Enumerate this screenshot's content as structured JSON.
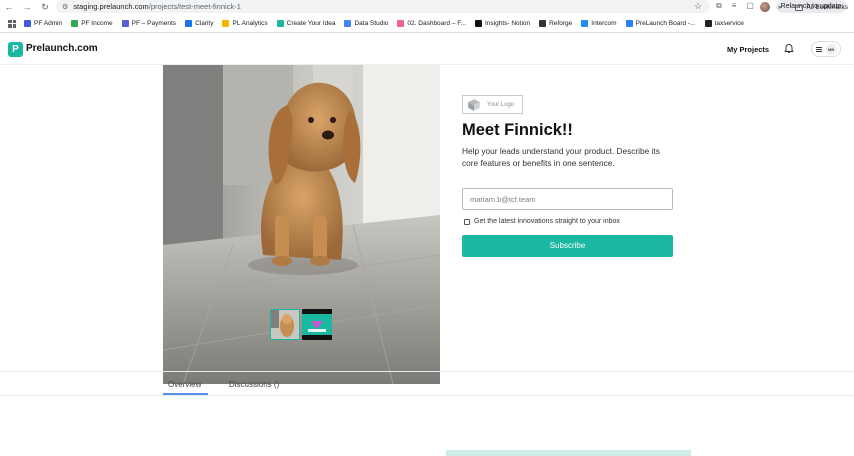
{
  "browser": {
    "url_host": "staging.prelaunch.com",
    "url_path": "/projects/test-meet-finnick-1",
    "relaunch_label": "Relaunch to update"
  },
  "bookmarks": [
    {
      "label": "PF Admin",
      "color": "#3b5bdb"
    },
    {
      "label": "PF Income",
      "color": "#34a853"
    },
    {
      "label": "PF – Payments",
      "color": "#5b5bd6"
    },
    {
      "label": "Clarity",
      "color": "#1a73e8"
    },
    {
      "label": "PL Analytics",
      "color": "#f4b400"
    },
    {
      "label": "Create Your Idea",
      "color": "#1ab8a0"
    },
    {
      "label": "Data Studio",
      "color": "#4285f4"
    },
    {
      "label": "02. Dashboard – F...",
      "color": "#f06292"
    },
    {
      "label": "Insights- Notion",
      "color": "#111111"
    },
    {
      "label": "Reforge",
      "color": "#333333"
    },
    {
      "label": "Intercom",
      "color": "#1f8ded"
    },
    {
      "label": "PreLaunch Board -...",
      "color": "#2d7ff9"
    },
    {
      "label": "taxservice",
      "color": "#222222"
    }
  ],
  "bookmarks_more": "»",
  "all_bookmarks": "All Bookmarks",
  "site": {
    "logo_text": "Prelaunch.com",
    "logo_mark": "P",
    "nav_my_projects": "My Projects",
    "user_initials": "MB"
  },
  "product": {
    "logo_placeholder": "Your Logo",
    "title": "Meet Finnick!!",
    "description": "Help your leads understand your product. Describe its core features or benefits in one sentence.",
    "email_value": "mariam.b@tcf.team",
    "consent_label": "Get the latest innovations straight to your inbox",
    "subscribe_label": "Subscribe"
  },
  "tabs": [
    {
      "label": "Overview"
    },
    {
      "label": "Discussions",
      "count": "()"
    }
  ],
  "colors": {
    "brand": "#1ab8a0",
    "tab_active": "#5b8de8"
  }
}
